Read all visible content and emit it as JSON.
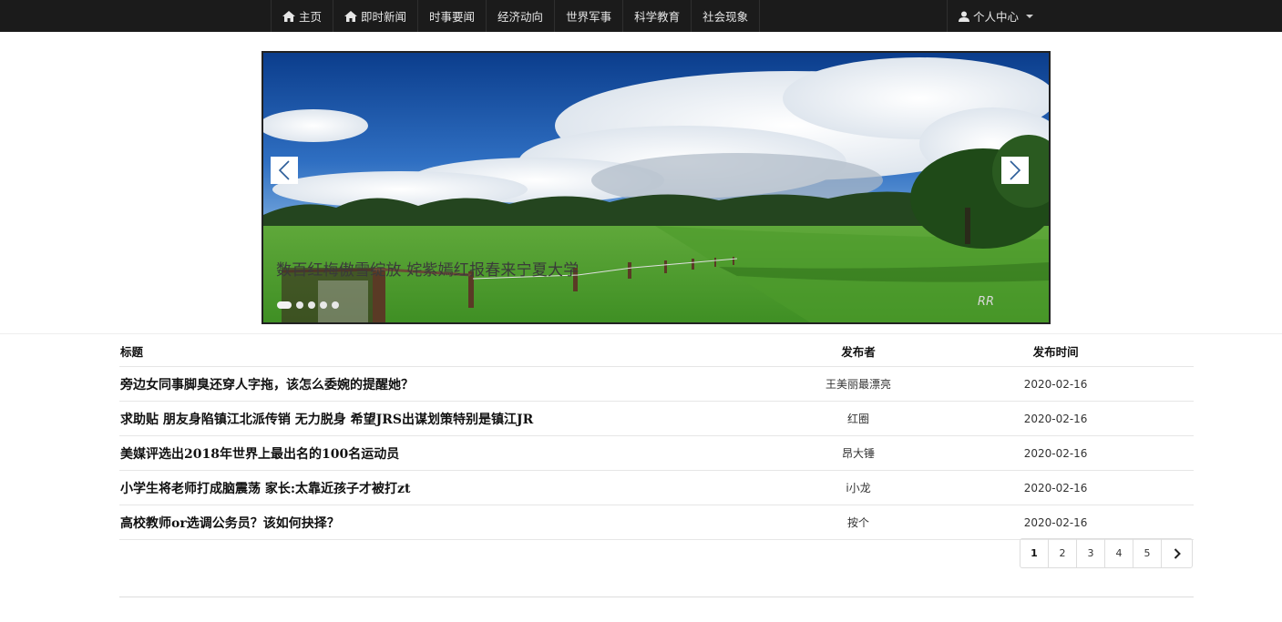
{
  "nav": {
    "items": [
      {
        "label": "主页",
        "icon": "home-icon"
      },
      {
        "label": "即时新闻",
        "icon": "home-icon"
      },
      {
        "label": "时事要闻",
        "icon": ""
      },
      {
        "label": "经济动向",
        "icon": ""
      },
      {
        "label": "世界军事",
        "icon": ""
      },
      {
        "label": "科学教育",
        "icon": ""
      },
      {
        "label": "社会现象",
        "icon": ""
      }
    ],
    "user_menu": {
      "label": "个人中心",
      "icon": "user-icon"
    }
  },
  "carousel": {
    "caption": "数百红梅傲雪绽放 姹紫嫣红报春来宁夏大学",
    "slide_count": 5,
    "active_index": 0,
    "watermark": "RR"
  },
  "table": {
    "headers": {
      "title": "标题",
      "author": "发布者",
      "date": "发布时间"
    },
    "rows": [
      {
        "title": "旁边女同事脚臭还穿人字拖，该怎么委婉的提醒她？",
        "author": "王美丽最漂亮",
        "date": "2020-02-16"
      },
      {
        "title": "求助贴 朋友身陷镇江北派传销 无力脱身 希望JRS出谋划策特别是镇江JR",
        "author": "红圈",
        "date": "2020-02-16"
      },
      {
        "title": "美媒评选出2018年世界上最出名的100名运动员",
        "author": "昂大锤",
        "date": "2020-02-16"
      },
      {
        "title": "小学生将老师打成脑震荡 家长:太靠近孩子才被打zt",
        "author": "i小龙",
        "date": "2020-02-16"
      },
      {
        "title": "高校教师or选调公务员？该如何抉择？",
        "author": "按个",
        "date": "2020-02-16"
      }
    ]
  },
  "pagination": {
    "pages": [
      "1",
      "2",
      "3",
      "4",
      "5"
    ],
    "active": "1",
    "next_icon": "chevron-right-icon"
  }
}
